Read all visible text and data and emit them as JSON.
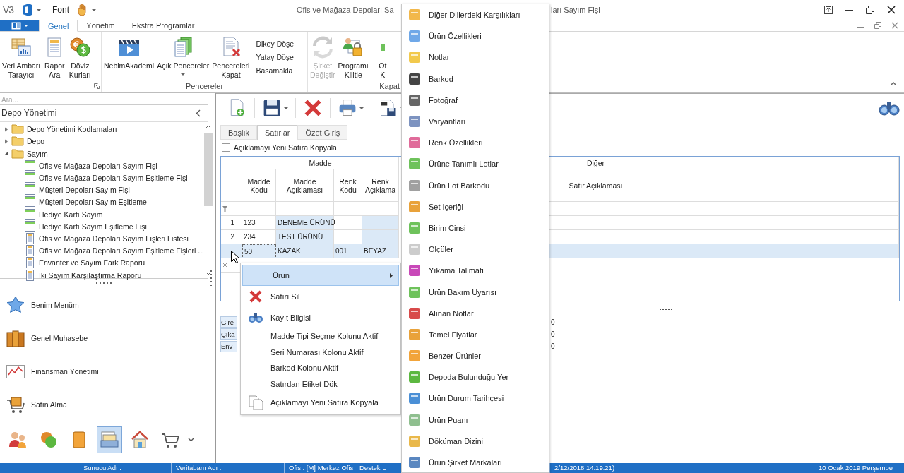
{
  "title_bar": {
    "logo": "V3",
    "quick_access_label": "Font",
    "title_start": "Ofis ve Mağaza Depoları Sa",
    "title_end": "ları Sayım Fişi"
  },
  "ribbon": {
    "tabs": [
      {
        "label": "Genel",
        "selected": true
      },
      {
        "label": "Yönetim",
        "selected": false
      },
      {
        "label": "Ekstra Programlar",
        "selected": false
      }
    ],
    "groups": [
      {
        "launcher": true,
        "items": [
          {
            "kind": "large",
            "lines": [
              "Veri Ambarı",
              "Tarayıcı"
            ],
            "disabled": false,
            "dropdown": false
          },
          {
            "kind": "large",
            "lines": [
              "Rapor",
              "Ara"
            ],
            "disabled": false,
            "dropdown": false
          },
          {
            "kind": "large",
            "lines": [
              "Döviz",
              "Kurları"
            ],
            "disabled": false,
            "dropdown": false
          }
        ]
      },
      {
        "label": "Pencereler",
        "items": [
          {
            "kind": "large",
            "lines": [
              "NebimAkademi"
            ],
            "disabled": false,
            "dropdown": false
          },
          {
            "kind": "large",
            "lines": [
              "Açık Pencereler"
            ],
            "disabled": false,
            "dropdown": true
          },
          {
            "kind": "large",
            "lines": [
              "Pencereleri",
              "Kapat"
            ],
            "disabled": false,
            "dropdown": false
          },
          {
            "kind": "small",
            "labels": [
              "Dikey Döşe",
              "Yatay Döşe",
              "Basamakla"
            ]
          }
        ]
      },
      {
        "label": "Kapat",
        "items": [
          {
            "kind": "large",
            "lines": [
              "Şirket",
              "Değiştir"
            ],
            "disabled": true,
            "dropdown": false
          },
          {
            "kind": "large",
            "lines": [
              "Programı",
              "Kilitle"
            ],
            "disabled": false,
            "dropdown": false
          },
          {
            "kind": "large",
            "lines": [
              "Ot",
              "K"
            ],
            "disabled": false,
            "dropdown": false
          }
        ]
      }
    ]
  },
  "left_panel": {
    "search": {
      "placeholder": "Ara..."
    },
    "title": "Depo Yönetimi",
    "tree": [
      {
        "label": "Depo Yönetimi Kodlamaları",
        "kind": "folder",
        "expanded": false
      },
      {
        "label": "Depo",
        "kind": "folder",
        "expanded": false
      },
      {
        "label": "Sayım",
        "kind": "folder",
        "expanded": true,
        "children": [
          {
            "label": "Ofis ve Mağaza Depoları Sayım Fişi",
            "kind": "form"
          },
          {
            "label": "Ofis ve Mağaza Depoları Sayım Eşitleme Fişi",
            "kind": "form"
          },
          {
            "label": "Müşteri Depoları Sayım Fişi",
            "kind": "form"
          },
          {
            "label": "Müşteri Depoları Sayım Eşitleme",
            "kind": "form"
          },
          {
            "label": "Hediye Kartı Sayım",
            "kind": "form"
          },
          {
            "label": "Hediye Kartı Sayım Eşitleme Fişi",
            "kind": "form"
          },
          {
            "label": "Ofis ve Mağaza Depoları Sayım Fişleri Listesi",
            "kind": "report"
          },
          {
            "label": "Ofis ve Mağaza Depoları Sayım Eşitleme Fişleri ...",
            "kind": "report"
          },
          {
            "label": "Envanter ve Sayım Fark Raporu",
            "kind": "report"
          },
          {
            "label": "İki Sayım Karşılaştırma Raporu",
            "kind": "report"
          }
        ]
      }
    ],
    "nav_items": [
      {
        "label": "Benim Menüm"
      },
      {
        "label": "Genel Muhasebe"
      },
      {
        "label": "Finansman Yönetimi"
      },
      {
        "label": "Satın Alma"
      }
    ],
    "nav_icons": [
      {
        "selected": false
      },
      {
        "selected": false
      },
      {
        "selected": false
      },
      {
        "selected": true
      },
      {
        "selected": false
      },
      {
        "selected": false
      }
    ]
  },
  "document": {
    "toolbar": [
      {
        "dropdown": false
      },
      {
        "dropdown": true
      },
      {
        "dropdown": false
      },
      {
        "dropdown": true
      },
      {
        "dropdown": true
      }
    ],
    "tabs": [
      {
        "label": "Başlık",
        "selected": false
      },
      {
        "label": "Satırlar",
        "selected": true
      },
      {
        "label": "Özet Giriş",
        "selected": false
      }
    ],
    "copy_checkbox": {
      "label": "Açıklamayı Yeni Satıra Kopyala",
      "checked": false
    },
    "grid": {
      "groups": [
        {
          "label": "Madde",
          "columns": [
            {
              "label": "Madde Kodu",
              "readonly": false
            },
            {
              "label": "Madde Açıklaması",
              "readonly": true
            },
            {
              "label": "Renk Kodu",
              "readonly": false
            },
            {
              "label": "Renk Açıklama",
              "readonly": true
            }
          ]
        },
        {
          "label": "Diğer",
          "columns": [
            {
              "label": "Satır Açıklaması",
              "readonly": false
            }
          ]
        }
      ],
      "rows": [
        {
          "number": "1",
          "selected": false,
          "cells": [
            "123",
            "DENEME ÜRÜNÜ",
            null,
            null,
            null
          ]
        },
        {
          "number": "2",
          "selected": false,
          "cells": [
            "234",
            "TEST ÜRÜNÜ",
            null,
            null,
            null
          ]
        },
        {
          "selected": true,
          "edit_button": "...",
          "cells": [
            "50",
            "KAZAK",
            "001",
            "BEYAZ",
            null
          ]
        }
      ]
    },
    "summary": [
      {
        "label": "Gire",
        "value": "0"
      },
      {
        "label": "Çıka",
        "value": "0"
      },
      {
        "label": "Env",
        "value": "0"
      }
    ]
  },
  "context_menu": [
    {
      "label": "Ürün",
      "kind": "submenu",
      "selected": true
    },
    {
      "label": "Satırı Sil",
      "kind": "delete",
      "selected": false
    },
    {
      "label": "Kayıt Bilgisi",
      "kind": "info",
      "selected": false
    },
    {
      "label": "Madde Tipi Seçme Kolunu Aktif",
      "kind": "plain",
      "selected": false
    },
    {
      "label": "Seri Numarası Kolonu Aktif",
      "kind": "plain",
      "selected": false
    },
    {
      "label": "Barkod Kolonu Aktif",
      "kind": "plain",
      "selected": false
    },
    {
      "label": "Satırdan Etiket Dök",
      "kind": "plain",
      "selected": false
    },
    {
      "label": "Açıklamayı Yeni Satıra Kopyala",
      "kind": "copy",
      "selected": false
    }
  ],
  "submenu": [
    "Diğer Dillerdeki Karşılıkları",
    "Ürün Özellikleri",
    "Notlar",
    "Barkod",
    "Fotoğraf",
    "Varyantları",
    "Renk Özellikleri",
    "Ürüne Tanımlı Lotlar",
    "Ürün Lot Barkodu",
    "Set İçeriği",
    "Birim Cinsi",
    "Ölçüler",
    "Yıkama Talimatı",
    "Ürün Bakım Uyarısı",
    "Alınan Notlar",
    "Temel Fiyatlar",
    "Benzer Ürünler",
    "Depoda Bulunduğu Yer",
    "Ürün Durum Tarihçesi",
    "Ürün Puanı",
    "Döküman Dizini",
    "Ürün Şirket Markaları"
  ],
  "status_bar": [
    "Sunucu Adı :",
    "Veritabanı Adı :",
    "Ofis : [M] Merkez Ofis",
    "Destek L",
    "2/12/2018 14:19:21)",
    "10 Ocak 2019 Perşembe"
  ]
}
